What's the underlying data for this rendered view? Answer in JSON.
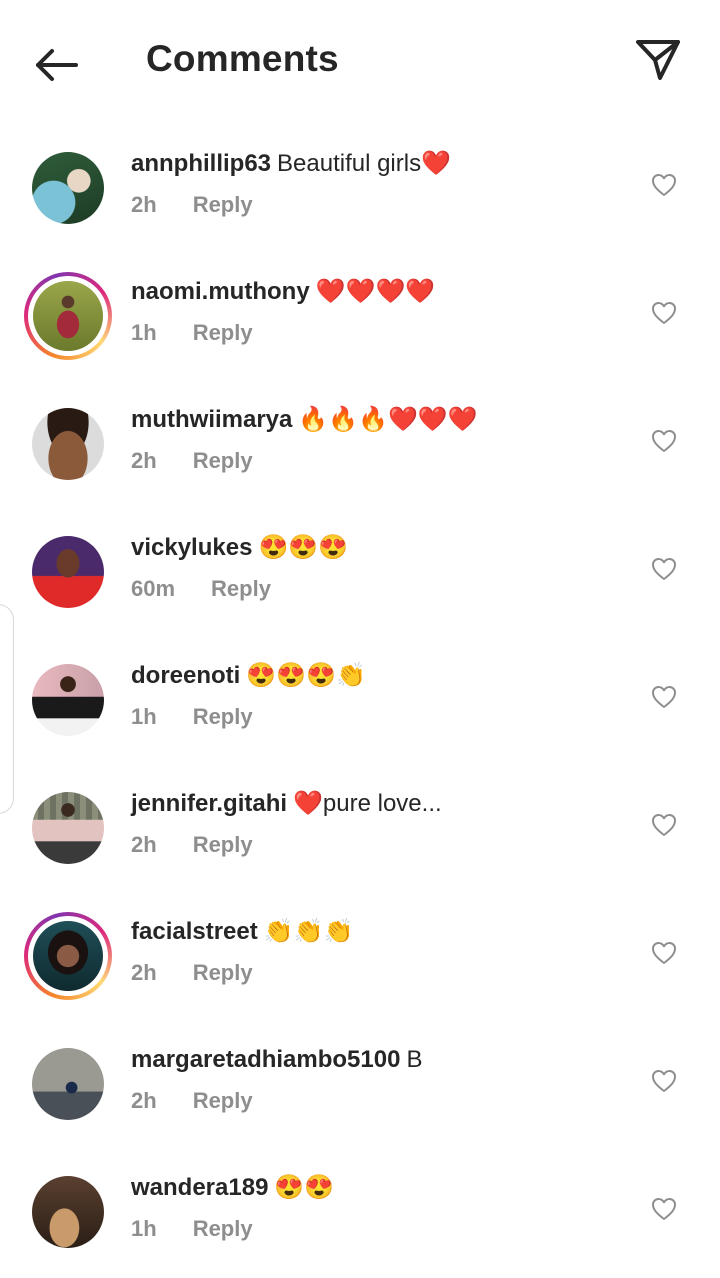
{
  "header": {
    "back_icon": "arrow-left-icon",
    "title": "Comments",
    "send_icon": "paper-plane-icon"
  },
  "comments": [
    {
      "username": "annphillip63",
      "text": "Beautiful girls❤️",
      "time": "2h",
      "reply": "Reply",
      "ring": false,
      "avatar_colors": [
        "#2f5d3a",
        "#7cc2d6"
      ]
    },
    {
      "username": "naomi.muthony",
      "text": "❤️❤️❤️❤️",
      "time": "1h",
      "reply": "Reply",
      "ring": true,
      "avatar_colors": [
        "#6b7a2c",
        "#a22a3a"
      ]
    },
    {
      "username": "muthwiimarya",
      "text": "🔥🔥🔥❤️❤️❤️",
      "time": "2h",
      "reply": "Reply",
      "ring": false,
      "avatar_colors": [
        "#2a1a14",
        "#8a5a3a"
      ]
    },
    {
      "username": "vickylukes",
      "text": "😍😍😍",
      "time": "60m",
      "reply": "Reply",
      "ring": false,
      "avatar_colors": [
        "#4a2a6a",
        "#e02a2a"
      ]
    },
    {
      "username": "doreenoti",
      "text": "😍😍😍👏",
      "time": "1h",
      "reply": "Reply",
      "ring": false,
      "avatar_colors": [
        "#e9b9bf",
        "#1a1a1a"
      ]
    },
    {
      "username": "jennifer.gitahi",
      "text": "❤️pure love...",
      "time": "2h",
      "reply": "Reply",
      "ring": false,
      "avatar_colors": [
        "#8b8f7a",
        "#e2c3c0"
      ]
    },
    {
      "username": "facialstreet",
      "text": "👏👏👏",
      "time": "2h",
      "reply": "Reply",
      "ring": true,
      "avatar_colors": [
        "#1f4f57",
        "#3a2a22"
      ]
    },
    {
      "username": "margaretadhiambo5100",
      "text": "B",
      "time": "2h",
      "reply": "Reply",
      "ring": false,
      "avatar_colors": [
        "#7a7a72",
        "#4a5058"
      ]
    },
    {
      "username": "wandera189",
      "text": "😍😍",
      "time": "1h",
      "reply": "Reply",
      "ring": false,
      "avatar_colors": [
        "#5a4030",
        "#c99a6a"
      ]
    }
  ],
  "like_icon": "heart-outline-icon"
}
